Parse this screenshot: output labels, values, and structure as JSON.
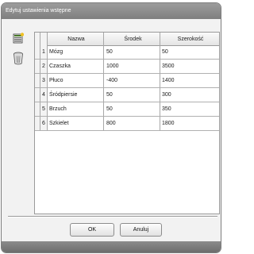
{
  "window": {
    "title": "Edytuj ustawienia wstępne"
  },
  "table": {
    "headers": [
      "Nazwa",
      "Środek",
      "Szerokość"
    ],
    "rows": [
      {
        "num": "1",
        "name": "Mózg",
        "center": "50",
        "width": "50"
      },
      {
        "num": "2",
        "name": "Czaszka",
        "center": "1000",
        "width": "3500"
      },
      {
        "num": "3",
        "name": "Płuco",
        "center": "-400",
        "width": "1400"
      },
      {
        "num": "4",
        "name": "Śródpiersie",
        "center": "50",
        "width": "300"
      },
      {
        "num": "5",
        "name": "Brzuch",
        "center": "50",
        "width": "350"
      },
      {
        "num": "6",
        "name": "Szkielet",
        "center": "800",
        "width": "1800"
      }
    ]
  },
  "sidebar": {
    "icons": [
      "add-row-icon",
      "delete-trash-icon"
    ]
  },
  "buttons": {
    "ok": "OK",
    "cancel": "Anuluj"
  }
}
